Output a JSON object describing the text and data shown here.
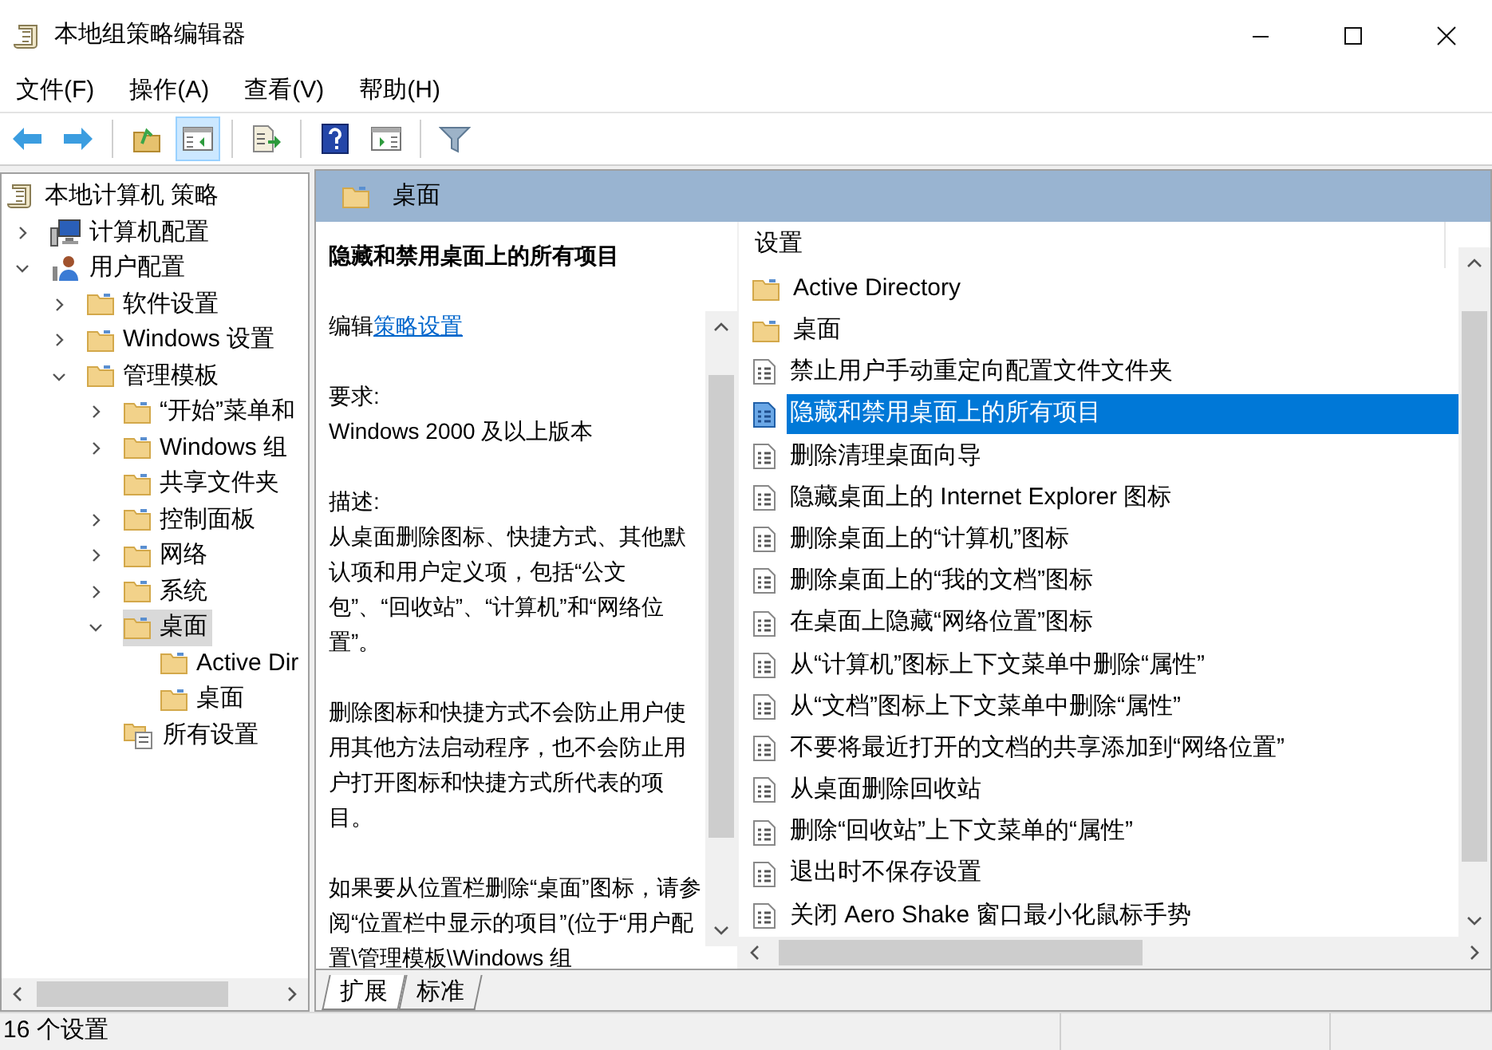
{
  "window": {
    "title": "本地组策略编辑器"
  },
  "menu": [
    "文件(F)",
    "操作(A)",
    "查看(V)",
    "帮助(H)"
  ],
  "toolbar": [
    {
      "kind": "back",
      "selected": false
    },
    {
      "kind": "forward",
      "selected": false
    },
    {
      "kind": "sep"
    },
    {
      "kind": "up",
      "selected": false
    },
    {
      "kind": "tree",
      "selected": true
    },
    {
      "kind": "sep"
    },
    {
      "kind": "export",
      "selected": false
    },
    {
      "kind": "sep"
    },
    {
      "kind": "help",
      "selected": false
    },
    {
      "kind": "action",
      "selected": false
    },
    {
      "kind": "sep"
    },
    {
      "kind": "filter",
      "selected": false
    }
  ],
  "tree": {
    "label": "本地计算机 策略",
    "kind": "scroll",
    "children": [
      {
        "label": "计算机配置",
        "kind": "computer",
        "expanded": false,
        "selected": false
      },
      {
        "label": "用户配置",
        "kind": "users",
        "expanded": true,
        "selected": false,
        "children": [
          {
            "label": "软件设置",
            "kind": "folder",
            "expanded": false,
            "selected": false
          },
          {
            "label": "Windows 设置",
            "kind": "folder",
            "expanded": false,
            "selected": false
          },
          {
            "label": "管理模板",
            "kind": "folder",
            "expanded": true,
            "selected": false,
            "children": [
              {
                "label": "“开始”菜单和",
                "kind": "folder",
                "expanded": false,
                "selected": false
              },
              {
                "label": "Windows 组",
                "kind": "folder",
                "expanded": false,
                "selected": false
              },
              {
                "label": "共享文件夹",
                "kind": "folder",
                "selected": false
              },
              {
                "label": "控制面板",
                "kind": "folder",
                "expanded": false,
                "selected": false
              },
              {
                "label": "网络",
                "kind": "folder",
                "expanded": false,
                "selected": false
              },
              {
                "label": "系统",
                "kind": "folder",
                "expanded": false,
                "selected": false
              },
              {
                "label": "桌面",
                "kind": "folder",
                "expanded": true,
                "selected": true,
                "children": [
                  {
                    "label": "Active Dir",
                    "kind": "folder",
                    "selected": false
                  },
                  {
                    "label": "桌面",
                    "kind": "folder",
                    "selected": false
                  }
                ]
              },
              {
                "label": "所有设置",
                "kind": "allsettings",
                "selected": false
              }
            ]
          }
        ]
      }
    ]
  },
  "header": {
    "title": "桌面"
  },
  "description": {
    "title": "隐藏和禁用桌面上的所有项目",
    "edit_prefix": "编辑",
    "edit_link": "策略设置",
    "requirements_label": "要求:",
    "requirements": "Windows 2000 及以上版本",
    "description_label": "描述:",
    "paragraphs": [
      "从桌面删除图标、快捷方式、其他默认项和用户定义项，包括“公文包”、“回收站”、“计算机”和“网络位置”。",
      "删除图标和快捷方式不会防止用户使用其他方法启动程序，也不会防止用户打开图标和快捷方式所代表的项目。",
      "如果要从位置栏删除“桌面”图标，请参阅“位置栏中显示的项目”(位于“用户配置\\管理模板\\Windows 组"
    ]
  },
  "list": {
    "column": "设置",
    "rows": [
      {
        "kind": "folder",
        "label": "Active Directory",
        "selected": false
      },
      {
        "kind": "folder",
        "label": "桌面",
        "selected": false
      },
      {
        "kind": "setting",
        "label": "禁止用户手动重定向配置文件文件夹",
        "selected": false
      },
      {
        "kind": "setting",
        "label": "隐藏和禁用桌面上的所有项目",
        "selected": true
      },
      {
        "kind": "setting",
        "label": "删除清理桌面向导",
        "selected": false
      },
      {
        "kind": "setting",
        "label": "隐藏桌面上的 Internet Explorer 图标",
        "selected": false
      },
      {
        "kind": "setting",
        "label": "删除桌面上的“计算机”图标",
        "selected": false
      },
      {
        "kind": "setting",
        "label": "删除桌面上的“我的文档”图标",
        "selected": false
      },
      {
        "kind": "setting",
        "label": "在桌面上隐藏“网络位置”图标",
        "selected": false
      },
      {
        "kind": "setting",
        "label": "从“计算机”图标上下文菜单中删除“属性”",
        "selected": false
      },
      {
        "kind": "setting",
        "label": "从“文档”图标上下文菜单中删除“属性”",
        "selected": false
      },
      {
        "kind": "setting",
        "label": "不要将最近打开的文档的共享添加到“网络位置”",
        "selected": false
      },
      {
        "kind": "setting",
        "label": "从桌面删除回收站",
        "selected": false
      },
      {
        "kind": "setting",
        "label": "删除“回收站”上下文菜单的“属性”",
        "selected": false
      },
      {
        "kind": "setting",
        "label": "退出时不保存设置",
        "selected": false
      },
      {
        "kind": "setting",
        "label": "关闭 Aero Shake 窗口最小化鼠标手势",
        "selected": false
      }
    ]
  },
  "tabs": [
    {
      "label": "扩展",
      "selected": true
    },
    {
      "label": "标准",
      "selected": false
    }
  ],
  "status_bar": {
    "text": "16 个设置"
  }
}
